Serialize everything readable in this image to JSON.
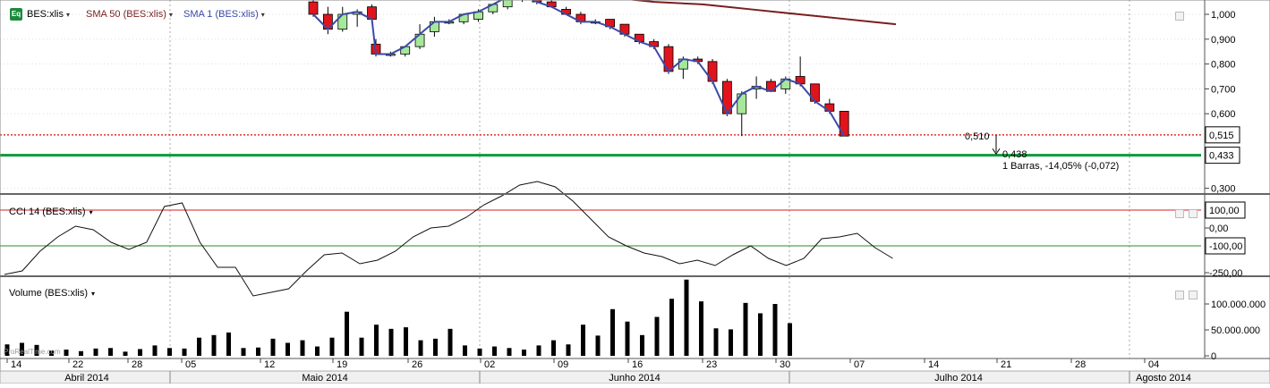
{
  "legend": {
    "main_series": "BES:xlis",
    "sma50": "SMA 50 (BES:xlis)",
    "sma1": "SMA 1 (BES:xlis)",
    "cci": "CCI 14 (BES:xlis)",
    "volume": "Volume (BES:xlis)",
    "caret": "▾",
    "eq_icon": "Eq"
  },
  "colors": {
    "up": "#a6e89a",
    "down": "#e0141c",
    "sma1": "#3b4aa8",
    "sma50": "#7a1e1e",
    "support": "#0a9a3a",
    "resistance": "#e23030",
    "cci_line": "#111111",
    "cci_upper": "#d42020",
    "cci_lower": "#2a8a2a"
  },
  "price_axis": {
    "ticks": [
      "1,000",
      "0,900",
      "0,800",
      "0,700",
      "0,600",
      "0,300"
    ],
    "tick_values": [
      1.0,
      0.9,
      0.8,
      0.7,
      0.6,
      0.3
    ],
    "boxes": [
      {
        "label": "0,515",
        "value": 0.515
      },
      {
        "label": "0,433",
        "value": 0.433
      }
    ]
  },
  "annotations": {
    "start_value": "0,510",
    "end_value": "0,438",
    "measure": "1 Barras, -14,05% (-0,072)"
  },
  "cci_axis": {
    "ticks": [
      "100,00",
      "0,00",
      "-100,00",
      "-250,00"
    ],
    "tick_values": [
      100,
      0,
      -100,
      -250
    ]
  },
  "volume_axis": {
    "ticks": [
      "100.000.000",
      "50.000.000",
      "0"
    ],
    "tick_values": [
      100000000,
      50000000,
      0
    ]
  },
  "watermark": "ProRealTime.com",
  "x_axis": {
    "day_labels": [
      "14",
      "22",
      "28",
      "05",
      "12",
      "19",
      "26",
      "02",
      "09",
      "16",
      "23",
      "30",
      "07",
      "14",
      "21",
      "28",
      "04"
    ],
    "month_labels": [
      "Abril 2014",
      "Maio 2014",
      "Junho 2014",
      "Julho 2014",
      "Agosto 2014"
    ]
  },
  "chart_data": {
    "type": "candlestick",
    "instrument": "BES:xlis",
    "visible_date_range": [
      "2014-04-14",
      "2014-07-10"
    ],
    "price_range": [
      0.28,
      1.03
    ],
    "support_level": 0.433,
    "resistance_level": 0.515,
    "candles": [
      {
        "o": 1.05,
        "h": 1.09,
        "l": 0.99,
        "c": 1.0
      },
      {
        "o": 1.0,
        "h": 1.03,
        "l": 0.92,
        "c": 0.94
      },
      {
        "o": 0.94,
        "h": 1.03,
        "l": 0.93,
        "c": 1.0
      },
      {
        "o": 1.0,
        "h": 1.02,
        "l": 0.95,
        "c": 1.01
      },
      {
        "o": 1.03,
        "h": 1.04,
        "l": 0.98,
        "c": 0.98
      },
      {
        "o": 0.88,
        "h": 0.9,
        "l": 0.83,
        "c": 0.84
      },
      {
        "o": 0.84,
        "h": 0.85,
        "l": 0.83,
        "c": 0.84
      },
      {
        "o": 0.84,
        "h": 0.87,
        "l": 0.83,
        "c": 0.87
      },
      {
        "o": 0.87,
        "h": 0.96,
        "l": 0.86,
        "c": 0.92
      },
      {
        "o": 0.93,
        "h": 0.99,
        "l": 0.91,
        "c": 0.97
      },
      {
        "o": 0.97,
        "h": 0.98,
        "l": 0.96,
        "c": 0.97
      },
      {
        "o": 0.97,
        "h": 1.0,
        "l": 0.96,
        "c": 1.0
      },
      {
        "o": 0.98,
        "h": 1.02,
        "l": 0.97,
        "c": 1.01
      },
      {
        "o": 1.01,
        "h": 1.04,
        "l": 1.0,
        "c": 1.04
      },
      {
        "o": 1.03,
        "h": 1.07,
        "l": 1.02,
        "c": 1.07
      },
      {
        "o": 1.07,
        "h": 1.08,
        "l": 1.05,
        "c": 1.08
      },
      {
        "o": 1.06,
        "h": 1.08,
        "l": 1.04,
        "c": 1.05
      },
      {
        "o": 1.05,
        "h": 1.06,
        "l": 1.03,
        "c": 1.03
      },
      {
        "o": 1.02,
        "h": 1.03,
        "l": 1.0,
        "c": 1.0
      },
      {
        "o": 1.0,
        "h": 1.01,
        "l": 0.96,
        "c": 0.97
      },
      {
        "o": 0.97,
        "h": 0.98,
        "l": 0.96,
        "c": 0.97
      },
      {
        "o": 0.98,
        "h": 0.98,
        "l": 0.94,
        "c": 0.95
      },
      {
        "o": 0.96,
        "h": 0.96,
        "l": 0.91,
        "c": 0.92
      },
      {
        "o": 0.92,
        "h": 0.92,
        "l": 0.88,
        "c": 0.89
      },
      {
        "o": 0.89,
        "h": 0.9,
        "l": 0.86,
        "c": 0.87
      },
      {
        "o": 0.87,
        "h": 0.88,
        "l": 0.76,
        "c": 0.77
      },
      {
        "o": 0.78,
        "h": 0.83,
        "l": 0.74,
        "c": 0.82
      },
      {
        "o": 0.82,
        "h": 0.83,
        "l": 0.8,
        "c": 0.81
      },
      {
        "o": 0.81,
        "h": 0.82,
        "l": 0.72,
        "c": 0.73
      },
      {
        "o": 0.73,
        "h": 0.74,
        "l": 0.59,
        "c": 0.6
      },
      {
        "o": 0.6,
        "h": 0.69,
        "l": 0.51,
        "c": 0.68
      },
      {
        "o": 0.7,
        "h": 0.75,
        "l": 0.66,
        "c": 0.71
      },
      {
        "o": 0.73,
        "h": 0.74,
        "l": 0.69,
        "c": 0.69
      },
      {
        "o": 0.7,
        "h": 0.75,
        "l": 0.68,
        "c": 0.74
      },
      {
        "o": 0.75,
        "h": 0.83,
        "l": 0.71,
        "c": 0.72
      },
      {
        "o": 0.72,
        "h": 0.72,
        "l": 0.64,
        "c": 0.65
      },
      {
        "o": 0.64,
        "h": 0.66,
        "l": 0.6,
        "c": 0.61
      },
      {
        "o": 0.61,
        "h": 0.61,
        "l": 0.51,
        "c": 0.51
      }
    ],
    "sma50": [
      1.08,
      1.07,
      1.06,
      1.05,
      1.045,
      1.04,
      1.03,
      1.02,
      1.01,
      1.0,
      0.99,
      0.98,
      0.97,
      0.96
    ],
    "cci": [
      -260,
      -240,
      -130,
      -50,
      10,
      -10,
      -80,
      -120,
      -80,
      120,
      140,
      -80,
      -220,
      -220,
      -380,
      -360,
      -340,
      -240,
      -150,
      -140,
      -200,
      -180,
      -130,
      -50,
      0,
      10,
      60,
      130,
      180,
      240,
      260,
      230,
      150,
      50,
      -50,
      -100,
      -140,
      -160,
      -200,
      -180,
      -210,
      -150,
      -100,
      -170,
      -210,
      -170,
      -60,
      -50,
      -30,
      -110,
      -170
    ],
    "cci_guides": [
      100,
      -100
    ],
    "volume": [
      22000000,
      25000000,
      21000000,
      10000000,
      12000000,
      9000000,
      14000000,
      15000000,
      8000000,
      13000000,
      20000000,
      15000000,
      14000000,
      35000000,
      40000000,
      45000000,
      15000000,
      16000000,
      33000000,
      25000000,
      30000000,
      18000000,
      35000000,
      85000000,
      35000000,
      60000000,
      52000000,
      55000000,
      30000000,
      33000000,
      52000000,
      20000000,
      14000000,
      18000000,
      15000000,
      12000000,
      20000000,
      30000000,
      22000000,
      60000000,
      39000000,
      90000000,
      66000000,
      40000000,
      75000000,
      110000000,
      147000000,
      105000000,
      53000000,
      51000000,
      102000000,
      82000000,
      100000000,
      63000000
    ]
  }
}
